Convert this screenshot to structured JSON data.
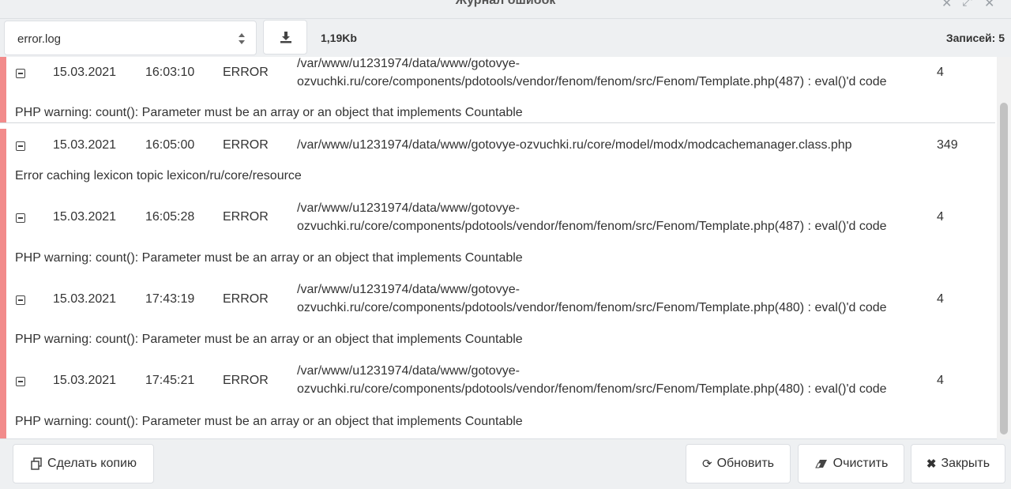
{
  "window": {
    "title": "Журнал ошибок"
  },
  "toolbar": {
    "file_select_value": "error.log",
    "file_size": "1,19Kb",
    "records_label": "Записей: 5"
  },
  "entries": [
    {
      "date": "15.03.2021",
      "time": "16:03:10",
      "level": "ERROR",
      "file_line1": "/var/www/u1231974/data/www/gotovye-",
      "file_line2": "ozvuchki.ru/core/components/pdotools/vendor/fenom/fenom/src/Fenom/Template.php(487) : eval()'d code",
      "line": "4",
      "message": "PHP warning: count(): Parameter must be an array or an object that implements Countable"
    },
    {
      "date": "15.03.2021",
      "time": "16:05:00",
      "level": "ERROR",
      "file_line1": "/var/www/u1231974/data/www/gotovye-ozvuchki.ru/core/model/modx/modcachemanager.class.php",
      "file_line2": "",
      "line": "349",
      "message": "Error caching lexicon topic lexicon/ru/core/resource"
    },
    {
      "date": "15.03.2021",
      "time": "16:05:28",
      "level": "ERROR",
      "file_line1": "/var/www/u1231974/data/www/gotovye-",
      "file_line2": "ozvuchki.ru/core/components/pdotools/vendor/fenom/fenom/src/Fenom/Template.php(487) : eval()'d code",
      "line": "4",
      "message": "PHP warning: count(): Parameter must be an array or an object that implements Countable"
    },
    {
      "date": "15.03.2021",
      "time": "17:43:19",
      "level": "ERROR",
      "file_line1": "/var/www/u1231974/data/www/gotovye-",
      "file_line2": "ozvuchki.ru/core/components/pdotools/vendor/fenom/fenom/src/Fenom/Template.php(480) : eval()'d code",
      "line": "4",
      "message": "PHP warning: count(): Parameter must be an array or an object that implements Countable"
    },
    {
      "date": "15.03.2021",
      "time": "17:45:21",
      "level": "ERROR",
      "file_line1": "/var/www/u1231974/data/www/gotovye-",
      "file_line2": "ozvuchki.ru/core/components/pdotools/vendor/fenom/fenom/src/Fenom/Template.php(480) : eval()'d code",
      "line": "4",
      "message": "PHP warning: count(): Parameter must be an array or an object that implements Countable"
    }
  ],
  "footer": {
    "copy_label": "Сделать копию",
    "refresh_label": "Обновить",
    "clear_label": "Очистить",
    "close_label": "Закрыть"
  },
  "colors": {
    "error_bar": "#f28b8b"
  }
}
